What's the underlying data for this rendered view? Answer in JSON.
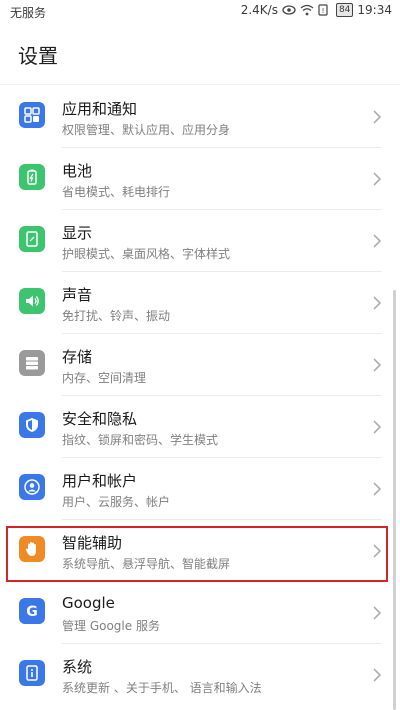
{
  "status_bar": {
    "carrier": "无服务",
    "speed": "2.4K/s",
    "battery": "84",
    "time": "19:34"
  },
  "page": {
    "title": "设置"
  },
  "items": [
    {
      "title": "应用和通知",
      "subtitle": "权限管理、默认应用、应用分身",
      "icon": "apps-icon",
      "color": "#3b78e7"
    },
    {
      "title": "电池",
      "subtitle": "省电模式、耗电排行",
      "icon": "battery-icon",
      "color": "#3cc46f"
    },
    {
      "title": "显示",
      "subtitle": "护眼模式、桌面风格、字体样式",
      "icon": "display-icon",
      "color": "#3cc46f"
    },
    {
      "title": "声音",
      "subtitle": "免打扰、铃声、振动",
      "icon": "sound-icon",
      "color": "#3cc46f"
    },
    {
      "title": "存储",
      "subtitle": "内存、空间清理",
      "icon": "storage-icon",
      "color": "#9a9a9a"
    },
    {
      "title": "安全和隐私",
      "subtitle": "指纹、锁屏和密码、学生模式",
      "icon": "shield-icon",
      "color": "#3b78e7"
    },
    {
      "title": "用户和帐户",
      "subtitle": "用户、云服务、帐户",
      "icon": "user-icon",
      "color": "#3b78e7"
    },
    {
      "title": "智能辅助",
      "subtitle": "系统导航、悬浮导航、智能截屏",
      "icon": "hand-icon",
      "color": "#f08a24"
    },
    {
      "title": "Google",
      "subtitle": "管理 Google 服务",
      "icon": "google-icon",
      "color": "#3b78e7"
    },
    {
      "title": "系统",
      "subtitle": "系统更新 、关于手机、 语言和输入法",
      "icon": "info-icon",
      "color": "#3b78e7"
    }
  ]
}
